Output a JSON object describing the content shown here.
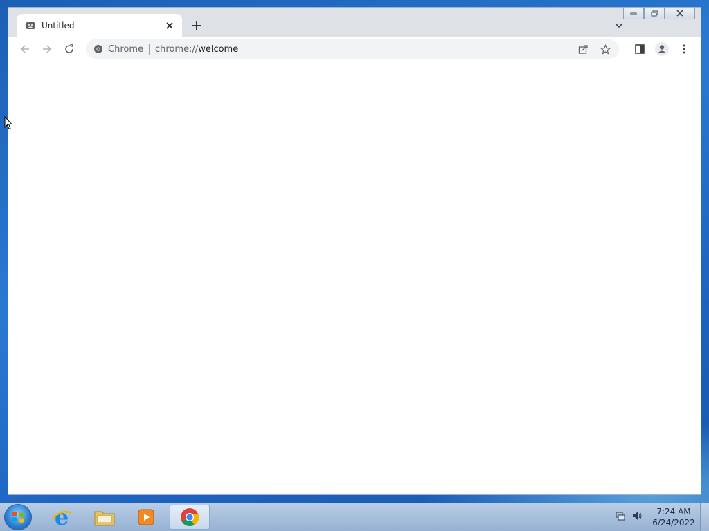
{
  "browser": {
    "tab": {
      "title": "Untitled",
      "favicon": "sad-page-icon"
    },
    "omnibox": {
      "chip_label": "Chrome",
      "url_prefix": "chrome://",
      "url_host": "welcome"
    },
    "toolbar_icons": [
      "back-icon",
      "forward-icon",
      "reload-icon",
      "share-icon",
      "star-icon",
      "side-panel-icon",
      "profile-icon",
      "menu-icon"
    ]
  },
  "taskbar": {
    "apps": [
      "start-orb",
      "internet-explorer",
      "file-explorer",
      "media-player",
      "google-chrome"
    ],
    "clock": {
      "time": "7:24 AM",
      "date": "6/24/2022"
    }
  },
  "colors": {
    "toolbar": "#ffffff",
    "tabstrip": "#dee1e6",
    "omnibox": "#f1f3f4",
    "desktop": "#1f6bc4"
  }
}
